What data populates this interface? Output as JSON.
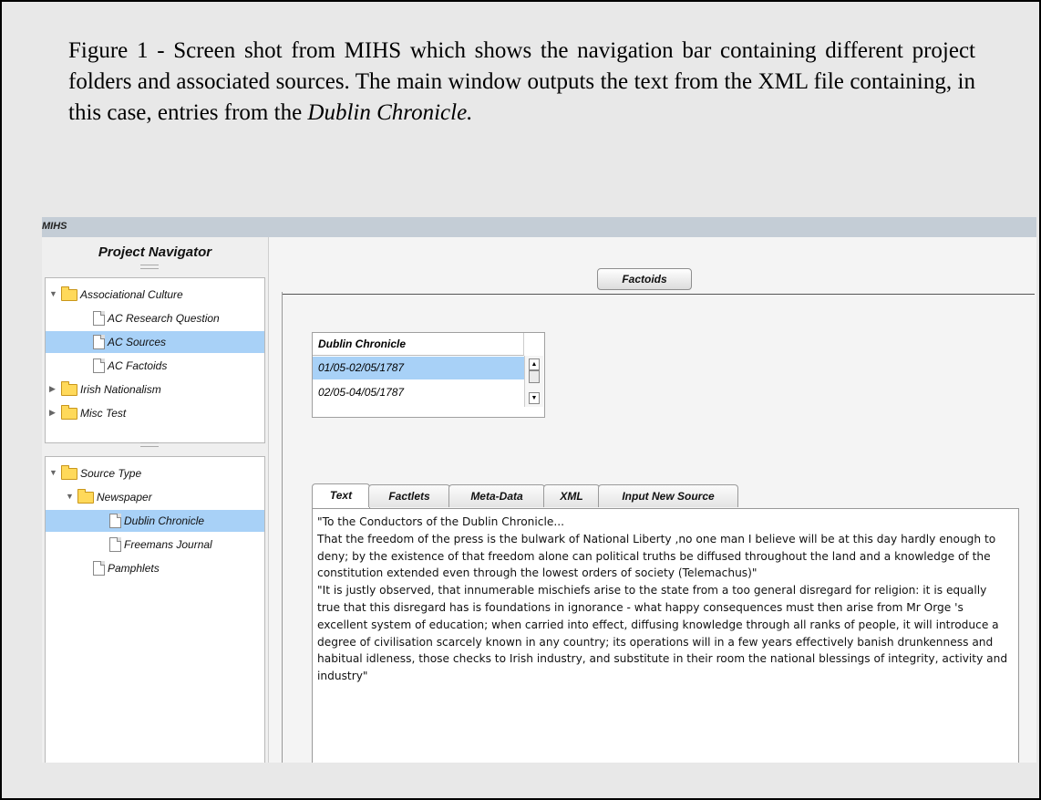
{
  "caption": {
    "text_before": "Figure 1 - Screen shot from MIHS which shows the navigation bar containing different project folders and associated sources. The main window outputs the text from the XML file containing, in this case, entries from the ",
    "text_italic": "Dublin Chronicle.",
    "text_after": ""
  },
  "app": {
    "title": "MIHS"
  },
  "navigator": {
    "title": "Project Navigator",
    "projects": [
      {
        "label": "Associational Culture",
        "type": "folder",
        "expanded": true,
        "level": 0
      },
      {
        "label": "AC Research Question",
        "type": "doc",
        "level": 1
      },
      {
        "label": "AC Sources",
        "type": "doc",
        "level": 1,
        "selected": true
      },
      {
        "label": "AC Factoids",
        "type": "doc",
        "level": 1
      },
      {
        "label": "Irish Nationalism",
        "type": "folder",
        "expanded": false,
        "level": 0
      },
      {
        "label": "Misc Test",
        "type": "folder",
        "expanded": false,
        "level": 0
      }
    ],
    "sources": [
      {
        "label": "Source Type",
        "type": "folder",
        "expanded": true,
        "level": 0
      },
      {
        "label": "Newspaper",
        "type": "folder",
        "expanded": true,
        "level": 1
      },
      {
        "label": "Dublin Chronicle",
        "type": "doc",
        "level": 2,
        "selected": true
      },
      {
        "label": "Freemans Journal",
        "type": "doc",
        "level": 2
      },
      {
        "label": "Pamphlets",
        "type": "doc",
        "level": 1
      }
    ]
  },
  "main": {
    "factoids_label": "Factoids",
    "source_list": {
      "header": "Dublin Chronicle",
      "rows": [
        {
          "label": "01/05-02/05/1787",
          "selected": true
        },
        {
          "label": "02/05-04/05/1787",
          "selected": false
        }
      ]
    },
    "tabs": [
      {
        "label": "Text",
        "active": true
      },
      {
        "label": "Factlets",
        "active": false
      },
      {
        "label": "Meta-Data",
        "active": false
      },
      {
        "label": "XML",
        "active": false
      },
      {
        "label": "Input New Source",
        "active": false
      }
    ],
    "text_content": "\"To the Conductors of the Dublin Chronicle...\nThat the freedom of the press is the bulwark of National Liberty ,no one man I believe will be at this day hardly enough to deny; by the existence of that freedom alone can political truths be diffused throughout the land and a knowledge of the constitution extended even through the lowest orders of society (Telemachus)\"\n\"It is justly observed, that innumerable mischiefs arise to the state from a too general disregard for religion: it is equally true that this disregard has is foundations in ignorance - what happy consequences must then arise from Mr Orge 's excellent system of education; when carried into effect, diffusing knowledge through all ranks of people, it will introduce a degree of civilisation scarcely known in any country; its operations will in a few years effectively banish drunkenness and habitual idleness, those checks to Irish industry, and substitute in their room the national blessings of integrity, activity and industry\""
  },
  "colors": {
    "selection": "#a8d1f7",
    "titlebar": "#c4cdd6",
    "folder": "#ffd95a"
  }
}
